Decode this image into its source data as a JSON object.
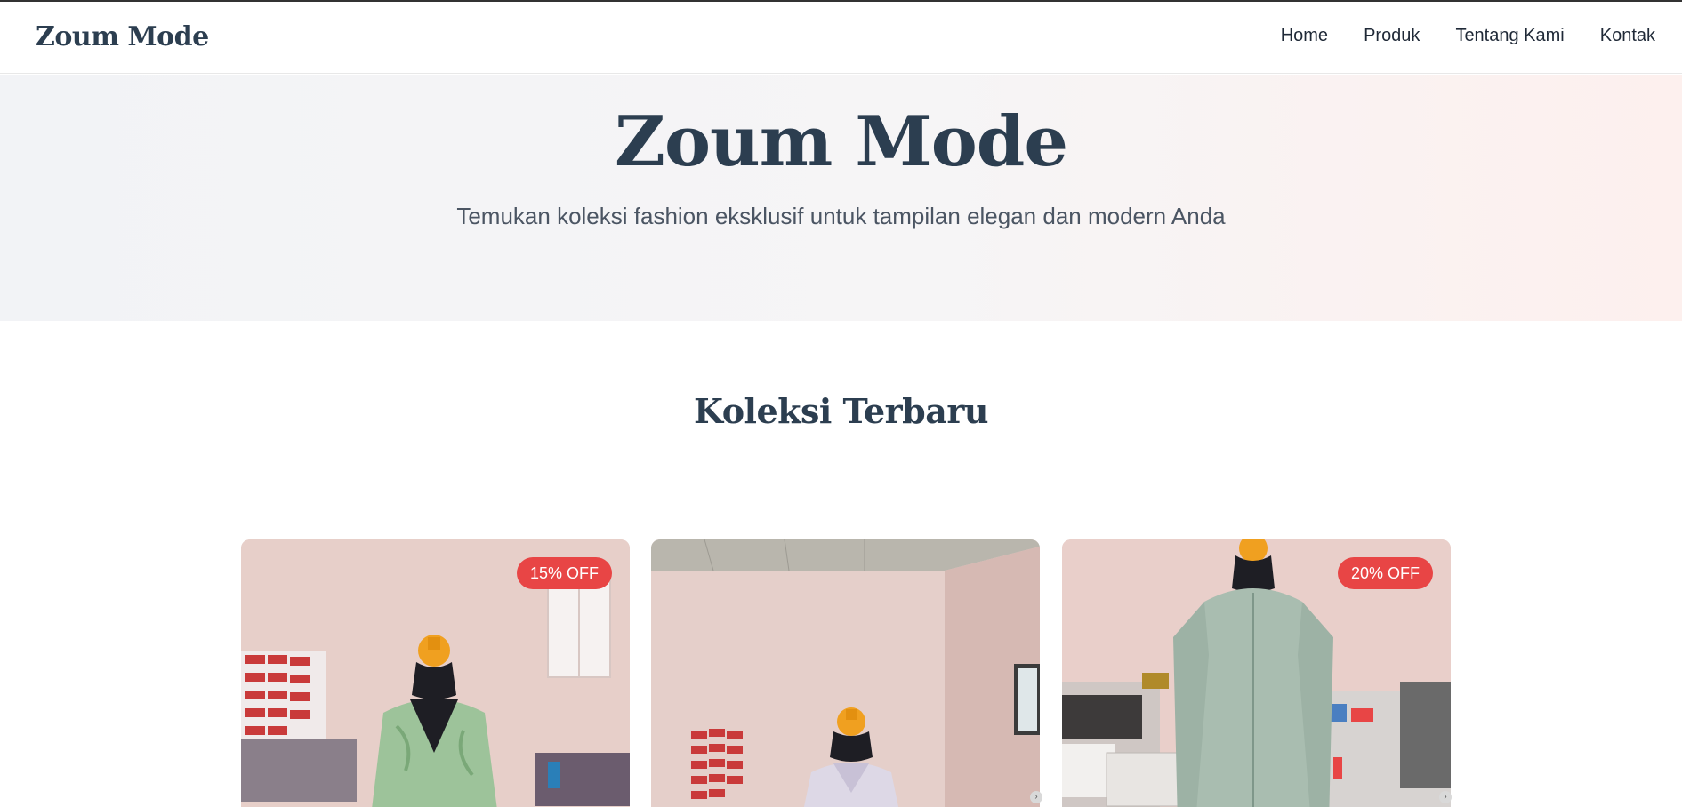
{
  "navbar": {
    "brand": "Zoum Mode",
    "links": [
      "Home",
      "Produk",
      "Tentang Kami",
      "Kontak"
    ]
  },
  "hero": {
    "title": "Zoum Mode",
    "subtitle": "Temukan koleksi fashion eksklusif untuk tampilan elegan dan modern Anda"
  },
  "collection": {
    "title": "Koleksi Terbaru",
    "products": [
      {
        "badge": "15% OFF",
        "image": "green-kebaya-on-mannequin"
      },
      {
        "badge": "",
        "image": "lilac-blouse-on-mannequin"
      },
      {
        "badge": "20% OFF",
        "image": "sage-long-jacket-on-mannequin"
      }
    ]
  },
  "colors": {
    "heading": "#2c3e50",
    "badge": "#e84545",
    "hero_bg_start": "#f2f3f6",
    "hero_bg_end": "#fdf0ee"
  }
}
